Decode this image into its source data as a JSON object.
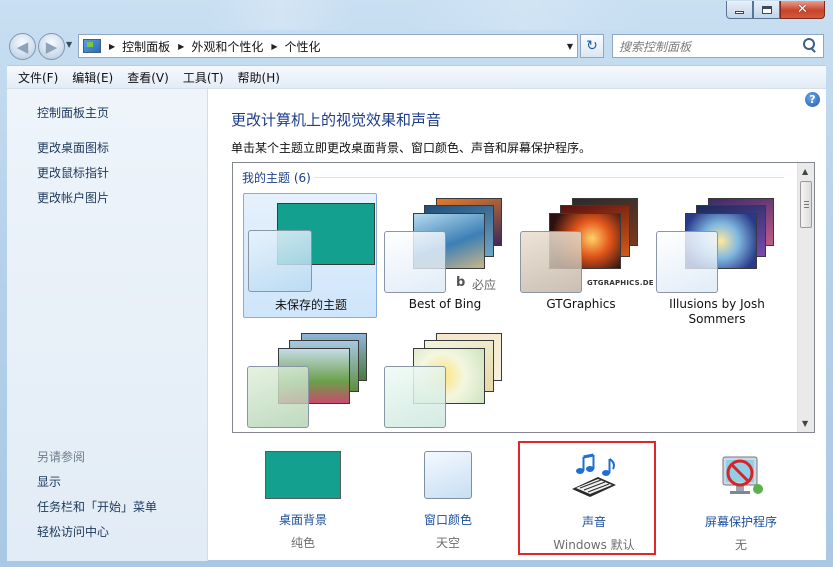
{
  "window": {
    "close_glyph": "✕"
  },
  "navigation": {
    "breadcrumbs": [
      "控制面板",
      "外观和个性化",
      "个性化"
    ],
    "search_placeholder": "搜索控制面板"
  },
  "menu": {
    "items": [
      "文件(F)",
      "编辑(E)",
      "查看(V)",
      "工具(T)",
      "帮助(H)"
    ]
  },
  "sidebar": {
    "links": [
      "控制面板主页",
      "更改桌面图标",
      "更改鼠标指针",
      "更改帐户图片"
    ],
    "see_also_heading": "另请参阅",
    "see_also": [
      "显示",
      "任务栏和「开始」菜单",
      "轻松访问中心"
    ]
  },
  "main": {
    "title": "更改计算机上的视觉效果和声音",
    "description": "单击某个主题立即更改桌面背景、窗口颜色、声音和屏幕保护程序。",
    "group_label": "我的主题 (6)",
    "themes": [
      {
        "name": "未保存的主题",
        "selected": true
      },
      {
        "name": "Best of Bing",
        "selected": false,
        "logo_text": "必应"
      },
      {
        "name": "GTGraphics",
        "selected": false,
        "logo_text": "GTGRAPHICS.DE"
      },
      {
        "name": "Illusions by Josh Sommers",
        "selected": false
      },
      {
        "name": "",
        "selected": false
      },
      {
        "name": "",
        "selected": false
      }
    ]
  },
  "settings": [
    {
      "label": "桌面背景",
      "value": "纯色",
      "icon": "desktop-background-icon",
      "color": "#14a08f"
    },
    {
      "label": "窗口颜色",
      "value": "天空",
      "icon": "window-color-icon",
      "color": "#cfe3f7"
    },
    {
      "label": "声音",
      "value": "Windows 默认",
      "icon": "sound-notes-icon",
      "highlighted": true
    },
    {
      "label": "屏幕保护程序",
      "value": "无",
      "icon": "screensaver-icon"
    }
  ],
  "colors": {
    "link": "#1b4f9c",
    "title": "#1e3e8a",
    "teal": "#14a08f",
    "highlight": "#e0252b"
  }
}
